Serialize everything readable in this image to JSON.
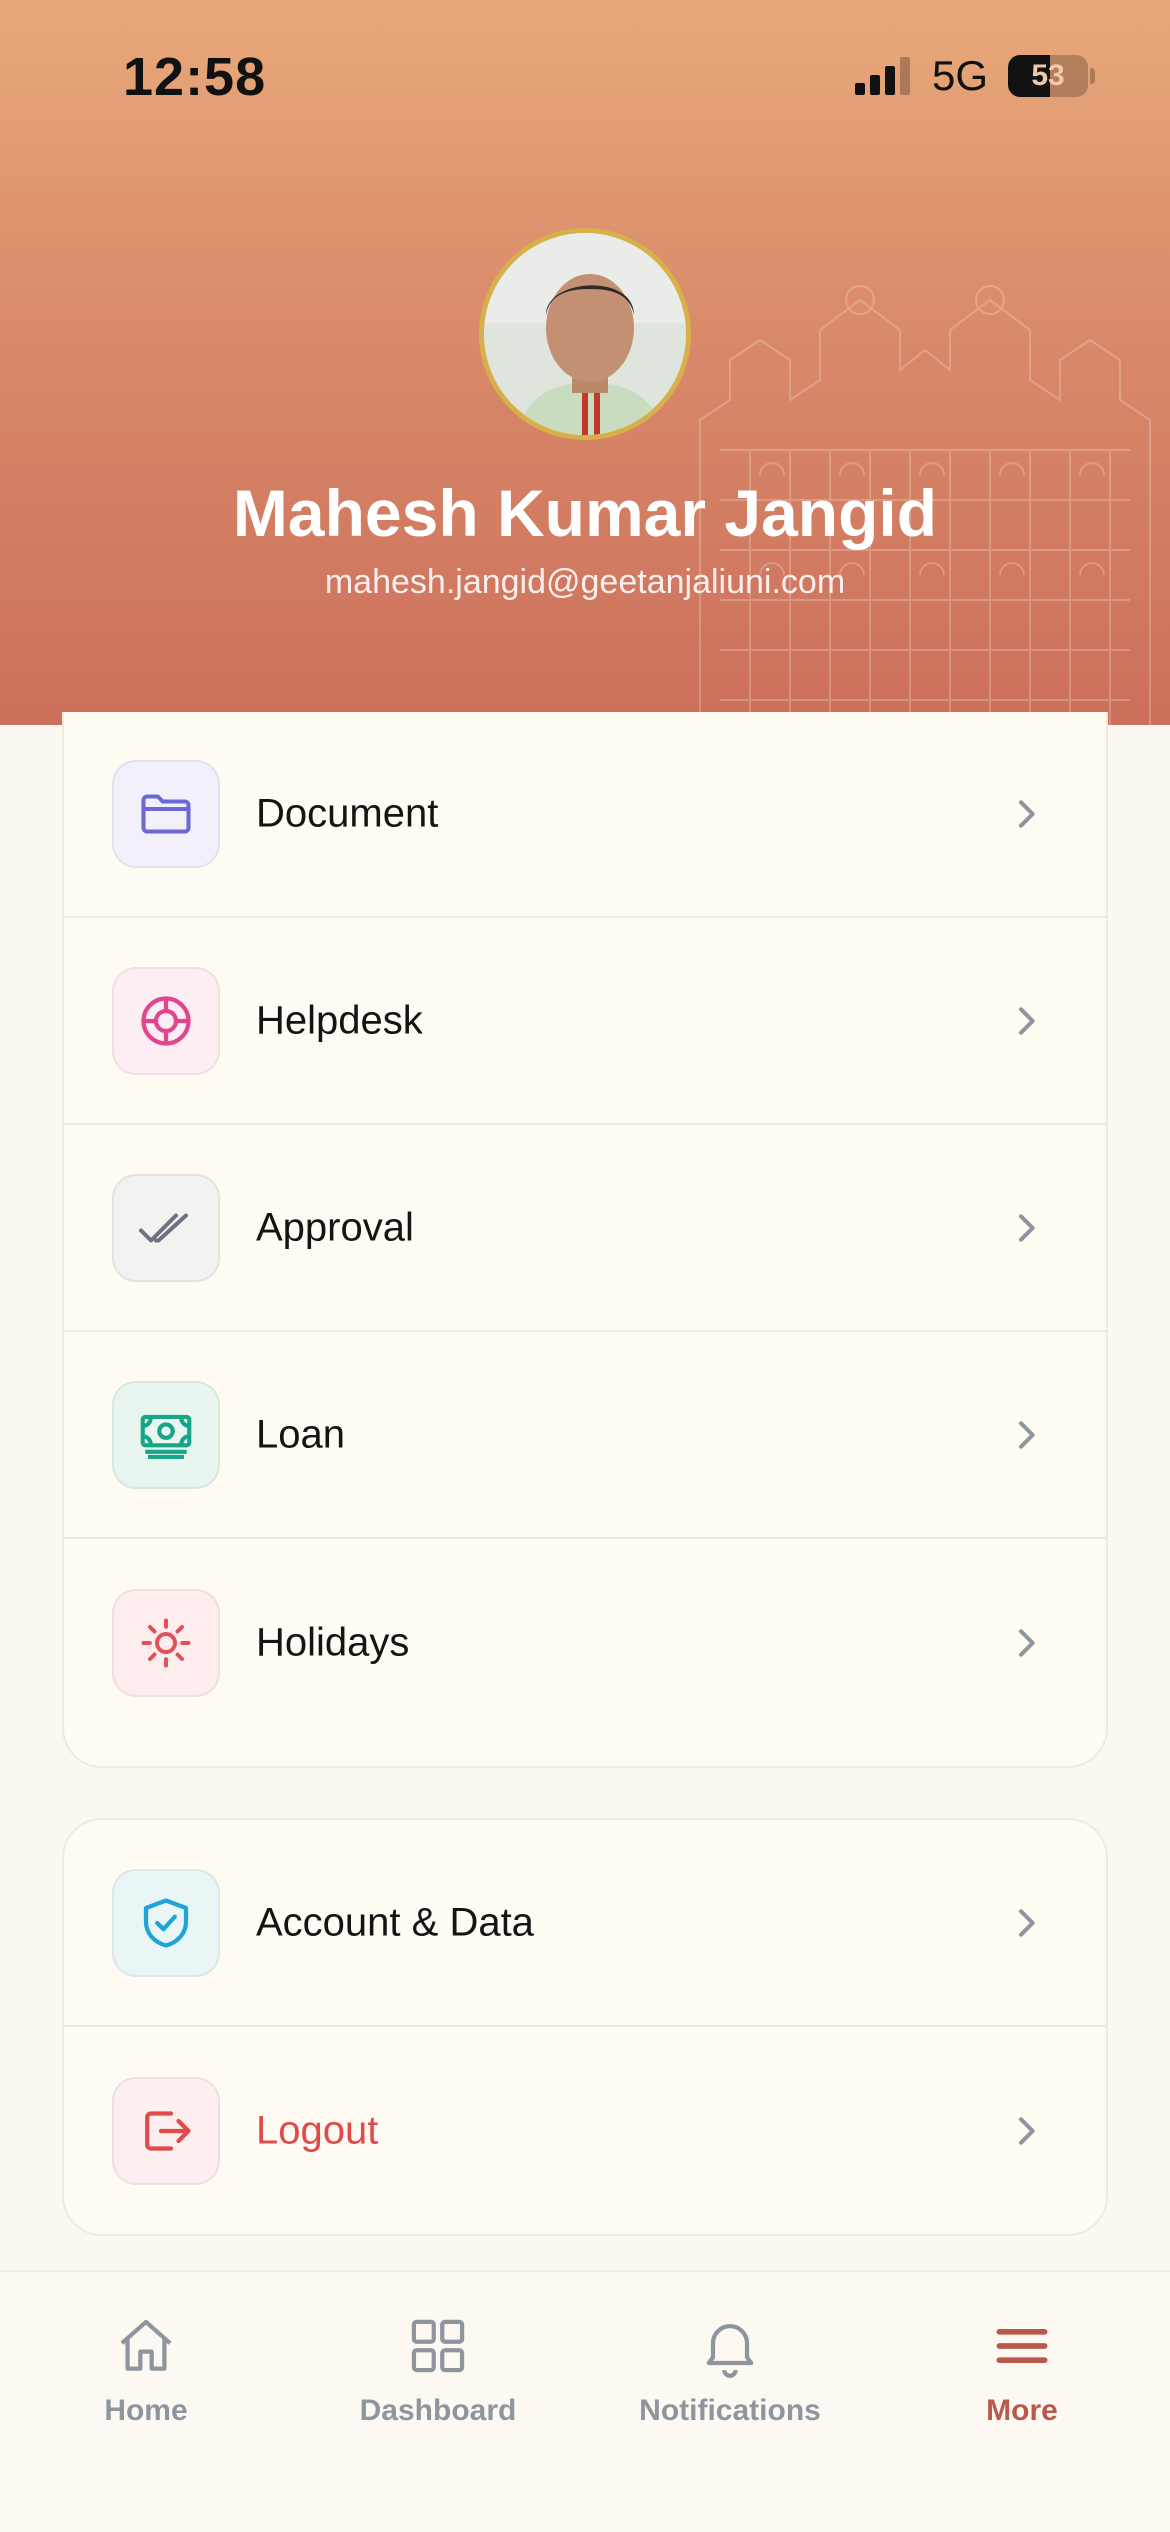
{
  "status_bar": {
    "time": "12:58",
    "network": "5G",
    "battery": "53",
    "battery_level_percent": 53
  },
  "profile": {
    "name": "Mahesh Kumar Jangid",
    "email": "mahesh.jangid@geetanjaliuni.com"
  },
  "menu_primary": [
    {
      "label": "Document",
      "icon": "folder-icon",
      "color": "#6b68d6",
      "bg": "#f1f0fb"
    },
    {
      "label": "Helpdesk",
      "icon": "lifebuoy-icon",
      "color": "#e2458e",
      "bg": "#fdeef4"
    },
    {
      "label": "Approval",
      "icon": "double-check-icon",
      "color": "#6b7280",
      "bg": "#f2f2f0"
    },
    {
      "label": "Loan",
      "icon": "cash-icon",
      "color": "#17a58a",
      "bg": "#e8f6ef"
    },
    {
      "label": "Holidays",
      "icon": "sun-icon",
      "color": "#e2505b",
      "bg": "#fdeeed"
    }
  ],
  "menu_secondary": [
    {
      "label": "Account & Data",
      "icon": "shield-check-icon",
      "color": "#1ea4d6",
      "bg": "#eaf6f6"
    },
    {
      "label": "Logout",
      "icon": "logout-icon",
      "color": "#e04a4a",
      "bg": "#fdeef0"
    }
  ],
  "tabbar": {
    "items": [
      {
        "label": "Home",
        "icon": "home-icon"
      },
      {
        "label": "Dashboard",
        "icon": "dashboard-icon"
      },
      {
        "label": "Notifications",
        "icon": "bell-icon"
      },
      {
        "label": "More",
        "icon": "menu-icon"
      }
    ],
    "active": "More",
    "active_color": "#b9594b",
    "inactive_color": "#8f959e"
  }
}
